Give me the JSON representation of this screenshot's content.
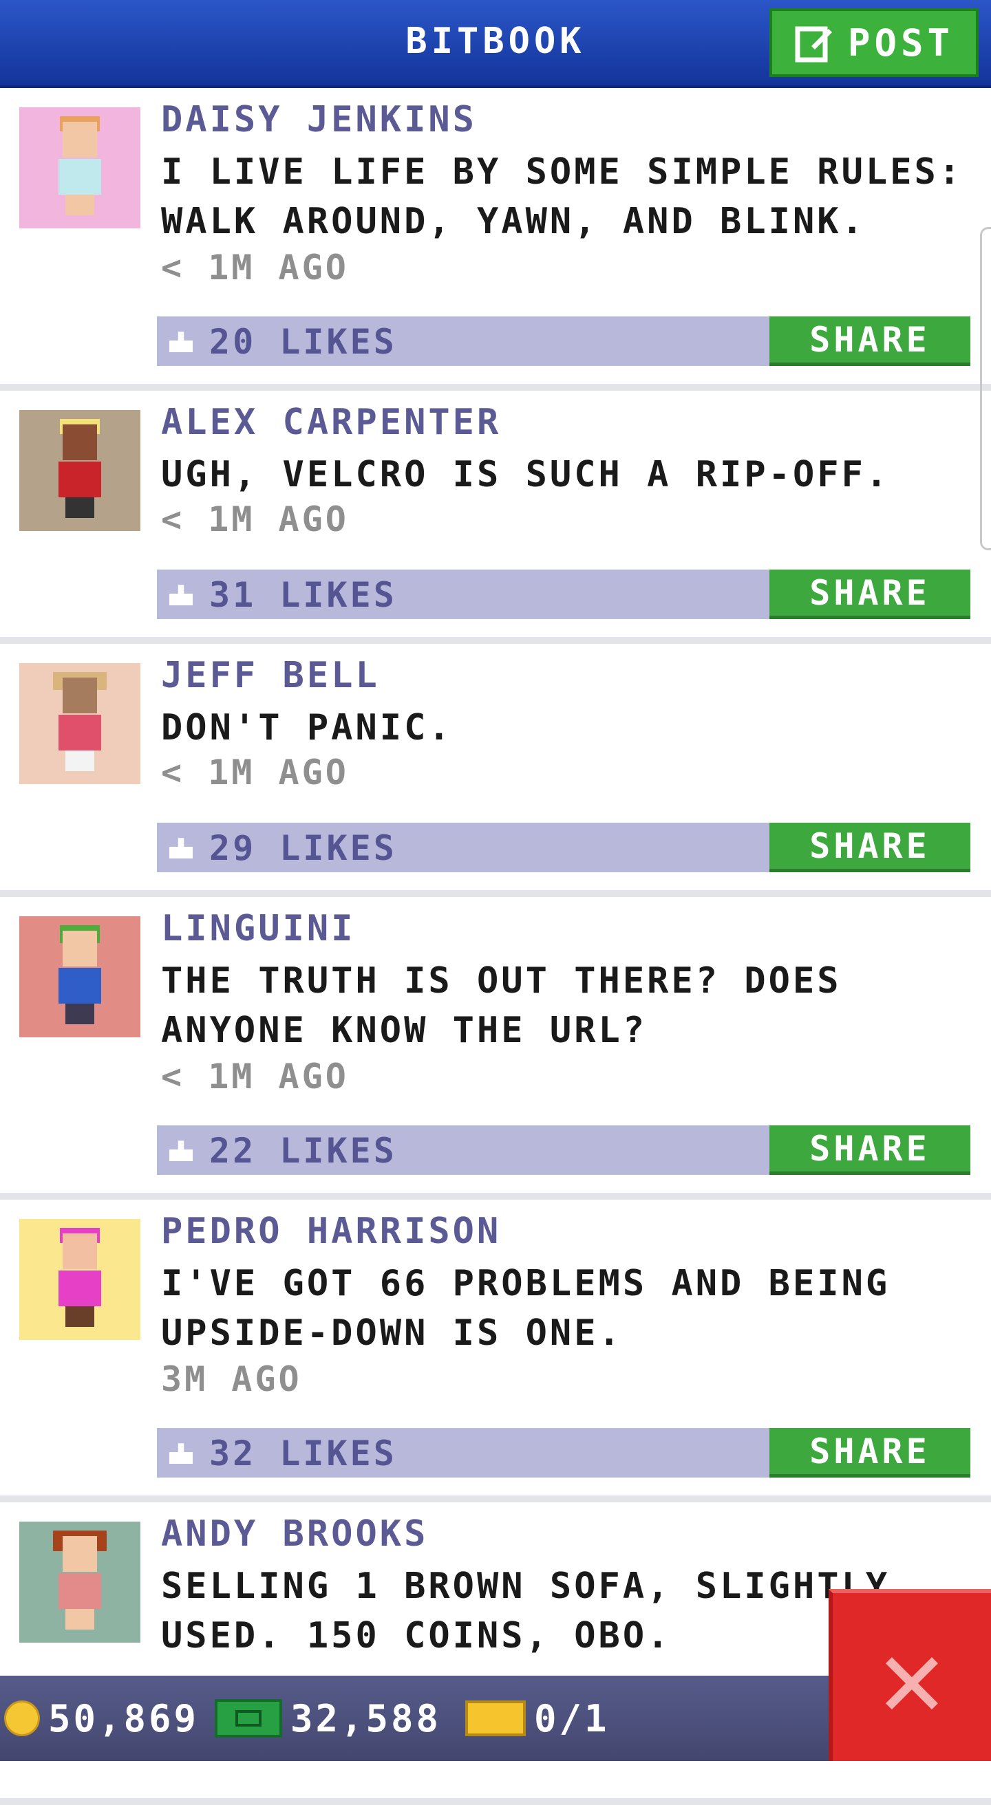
{
  "header": {
    "title": "BITBOOK",
    "post_label": "POST"
  },
  "posts": [
    {
      "name": "DAISY JENKINS",
      "message": "I LIVE LIFE BY SOME SIMPLE RULES: WALK AROUND, YAWN, AND BLINK.",
      "time": "< 1M AGO",
      "likes": "20 LIKES",
      "share_label": "SHARE",
      "avatar_bg": "#f2b6de"
    },
    {
      "name": "ALEX CARPENTER",
      "message": "UGH, VELCRO IS SUCH A RIP-OFF.",
      "time": "< 1M AGO",
      "likes": "31 LIKES",
      "share_label": "SHARE",
      "avatar_bg": "#b5a28a"
    },
    {
      "name": "JEFF BELL",
      "message": "DON'T PANIC.",
      "time": "< 1M AGO",
      "likes": "29 LIKES",
      "share_label": "SHARE",
      "avatar_bg": "#f0cdbb"
    },
    {
      "name": "LINGUINI",
      "message": "THE TRUTH IS OUT THERE? DOES ANYONE KNOW THE URL?",
      "time": "< 1M AGO",
      "likes": "22 LIKES",
      "share_label": "SHARE",
      "avatar_bg": "#e18d86"
    },
    {
      "name": "PEDRO HARRISON",
      "message": "I'VE GOT 66 PROBLEMS AND BEING UPSIDE-DOWN IS ONE.",
      "time": "3M AGO",
      "likes": "32 LIKES",
      "share_label": "SHARE",
      "avatar_bg": "#fbe88e"
    },
    {
      "name": "ANDY BROOKS",
      "message": "SELLING 1 BROWN SOFA, SLIGHTLY USED. 150 COINS, OBO.",
      "time": "",
      "likes": "",
      "share_label": "",
      "avatar_bg": "#8fb3a2"
    }
  ],
  "bottom_bar": {
    "coins": "50,869",
    "bux": "32,588",
    "tickets": "0/1"
  },
  "colors": {
    "header": "#1f45b3",
    "accent_green": "#3cb13c",
    "likes_bar": "#b7b8da",
    "name": "#5c5a94",
    "close": "#e02828"
  },
  "icons": {
    "post": "edit-icon",
    "like": "thumbs-up-icon",
    "coin": "coin-icon",
    "bux": "cash-icon",
    "ticket": "ticket-icon",
    "close": "close-icon"
  }
}
